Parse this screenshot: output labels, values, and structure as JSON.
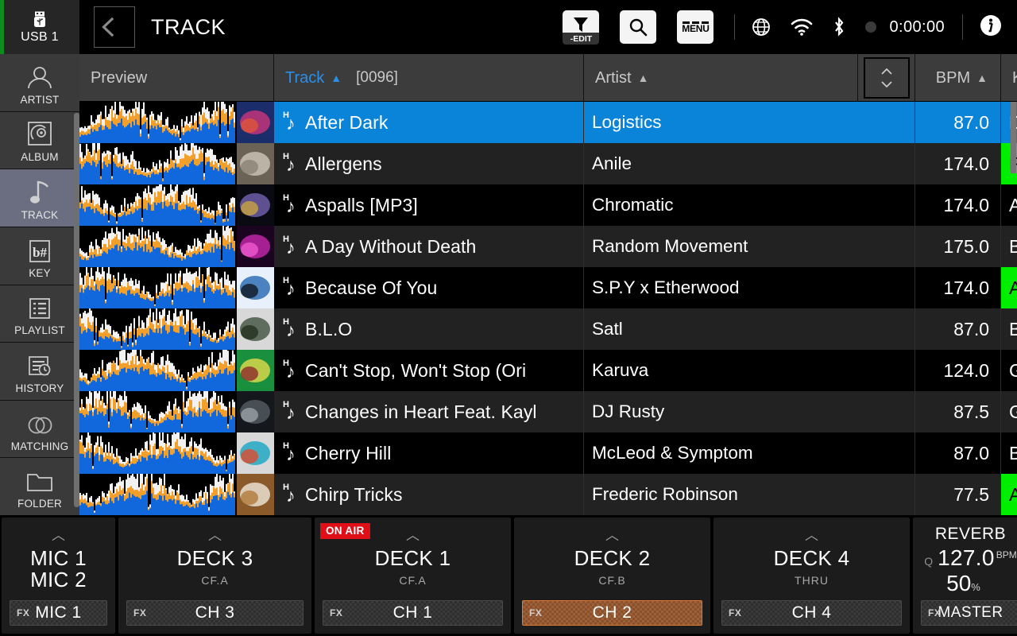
{
  "topbar": {
    "usb_label": "USB 1",
    "usb_icon": "usb-icon",
    "back_icon": "arrow-left-icon",
    "title": "TRACK",
    "filter_icon": "funnel-icon",
    "filter_tag": "-EDIT",
    "search_icon": "search-icon",
    "menu_label": "MENU",
    "globe_icon": "globe-icon",
    "wifi_icon": "wifi-icon",
    "bluetooth_icon": "bluetooth-icon",
    "rec_icon": "record-dot-icon",
    "clock": "0:00:00",
    "info_icon": "info-icon"
  },
  "sidebar": {
    "items": [
      {
        "label": "ARTIST",
        "icon": "person-icon",
        "active": false
      },
      {
        "label": "ALBUM",
        "icon": "disc-icon",
        "active": false
      },
      {
        "label": "TRACK",
        "icon": "note-icon",
        "active": true
      },
      {
        "label": "KEY",
        "icon": "key-bsharp-icon",
        "active": false
      },
      {
        "label": "PLAYLIST",
        "icon": "list-icon",
        "active": false
      },
      {
        "label": "HISTORY",
        "icon": "history-icon",
        "active": false
      },
      {
        "label": "MATCHING",
        "icon": "rings-icon",
        "active": false
      },
      {
        "label": "FOLDER",
        "icon": "folder-icon",
        "active": false
      }
    ]
  },
  "table": {
    "headers": {
      "preview": "Preview",
      "track": "Track",
      "track_count": "[0096]",
      "artist": "Artist",
      "bpm": "BPM",
      "key": "Key",
      "sort_arrow": "▲",
      "sort_toggle_icon": "sort-updown-icon"
    },
    "accent_selected": "#0a84d8",
    "accent_key_green": "#00ef00",
    "rows": [
      {
        "title": "After Dark",
        "artist": "Logistics",
        "bpm": "87.0",
        "key": "Dbm",
        "key_green": false,
        "selected": true
      },
      {
        "title": "Allergens",
        "artist": "Anile",
        "bpm": "174.0",
        "key": "Fm",
        "key_green": true,
        "selected": false
      },
      {
        "title": "Aspalls [MP3]",
        "artist": "Chromatic",
        "bpm": "174.0",
        "key": "Am",
        "key_green": false,
        "selected": false
      },
      {
        "title": "A Day Without Death",
        "artist": "Random Movement",
        "bpm": "175.0",
        "key": "Bm",
        "key_green": false,
        "selected": false
      },
      {
        "title": "Because Of You",
        "artist": "S.P.Y x Etherwood",
        "bpm": "174.0",
        "key": "Ab",
        "key_green": true,
        "selected": false
      },
      {
        "title": "B.L.O",
        "artist": "Satl",
        "bpm": "87.0",
        "key": "Bbm",
        "key_green": false,
        "selected": false
      },
      {
        "title": "Can't Stop, Won't Stop (Ori",
        "artist": "Karuva",
        "bpm": "124.0",
        "key": "Gm",
        "key_green": false,
        "selected": false
      },
      {
        "title": "Changes in Heart Feat. Kayl",
        "artist": "DJ Rusty",
        "bpm": "87.5",
        "key": "Gm",
        "key_green": false,
        "selected": false
      },
      {
        "title": "Cherry Hill",
        "artist": "McLeod & Symptom",
        "bpm": "87.0",
        "key": "B",
        "key_green": false,
        "selected": false
      },
      {
        "title": "Chirp Tricks",
        "artist": "Frederic Robinson",
        "bpm": "77.5",
        "key": "Ab",
        "key_green": true,
        "selected": false
      }
    ]
  },
  "decks": {
    "mic": {
      "name_line1": "MIC 1",
      "name_line2": "MIC 2",
      "fx_label": "FX",
      "fx_value": "MIC 1",
      "chevron": "chevron-up-icon"
    },
    "items": [
      {
        "name": "DECK 3",
        "sub": "CF.A",
        "fx_label": "FX",
        "fx_value": "CH 3",
        "on_air": false,
        "fx_active": false,
        "chevron": "chevron-up-icon"
      },
      {
        "name": "DECK 1",
        "sub": "CF.A",
        "fx_label": "FX",
        "fx_value": "CH 1",
        "on_air": true,
        "fx_active": false,
        "on_air_label": "ON AIR",
        "chevron": "chevron-up-icon"
      },
      {
        "name": "DECK 2",
        "sub": "CF.B",
        "fx_label": "FX",
        "fx_value": "CH 2",
        "on_air": false,
        "fx_active": true,
        "chevron": "chevron-up-icon"
      },
      {
        "name": "DECK 4",
        "sub": "THRU",
        "fx_label": "FX",
        "fx_value": "CH 4",
        "on_air": false,
        "fx_active": false,
        "chevron": "chevron-up-icon"
      }
    ],
    "fx": {
      "title": "REVERB",
      "q_label": "Q",
      "bpm_value": "127.0",
      "bpm_unit": "BPM",
      "percent": "50",
      "percent_unit": "%",
      "fx_label": "FX",
      "fx_value": "MASTER"
    }
  }
}
